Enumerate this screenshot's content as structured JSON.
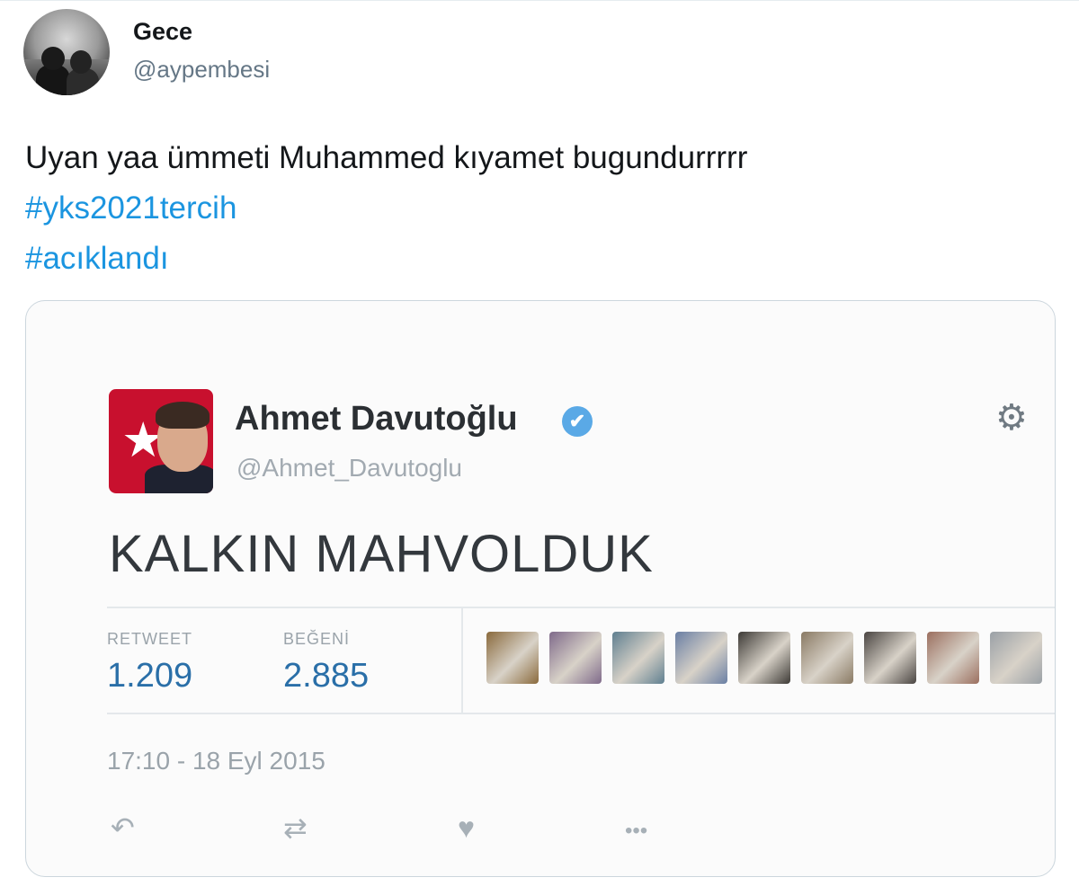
{
  "tweet": {
    "author_name": "Gece",
    "author_handle": "@aypembesi",
    "text_line": "Uyan yaa ümmeti Muhammed kıyamet bugundurrrrr",
    "hashtags": [
      "#yks2021tercih",
      "#acıklandı"
    ]
  },
  "embedded_tweet": {
    "author_name": "Ahmet Davutoğlu",
    "author_handle": "@Ahmet_Davutoglu",
    "verified_icon": "✔",
    "settings_icon": "⚙",
    "text": "KALKIN MAHVOLDUK",
    "stats": [
      {
        "label": "RETWEET",
        "value": "1.209"
      },
      {
        "label": "BEĞENİ",
        "value": "2.885"
      }
    ],
    "liker_colors": [
      "#8a6a3c",
      "#7f6a8a",
      "#5f7f90",
      "#6a7fa4",
      "#3d3a36",
      "#8a7a64",
      "#4a4542",
      "#9b6f5f",
      "#9aa0a6"
    ],
    "timestamp": "17:10 - 18 Eyl 2015",
    "actions": {
      "reply_icon": "↶",
      "retweet_icon": "⇄",
      "like_icon": "♥",
      "more_icon": "•••"
    }
  }
}
